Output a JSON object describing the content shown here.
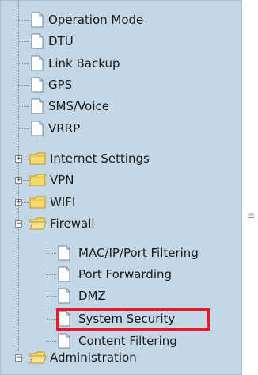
{
  "tree": {
    "items": [
      {
        "label": "Operation Mode"
      },
      {
        "label": "DTU"
      },
      {
        "label": "Link Backup"
      },
      {
        "label": "GPS"
      },
      {
        "label": "SMS/Voice"
      },
      {
        "label": "VRRP"
      },
      {
        "label": "Internet Settings",
        "toggle": "+"
      },
      {
        "label": "VPN",
        "toggle": "+"
      },
      {
        "label": "WIFI",
        "toggle": "+"
      },
      {
        "label": "Firewall",
        "toggle": "−"
      },
      {
        "label": "MAC/IP/Port Filtering"
      },
      {
        "label": "Port Forwarding"
      },
      {
        "label": "DMZ"
      },
      {
        "label": "System Security"
      },
      {
        "label": "Content Filtering"
      },
      {
        "label": "Administration",
        "toggle": "−"
      }
    ]
  },
  "splitter": {
    "glyph": "≡"
  },
  "colors": {
    "panel": "#c3d7e6",
    "highlight": "#e31b23",
    "folder": "#f6d96b"
  }
}
